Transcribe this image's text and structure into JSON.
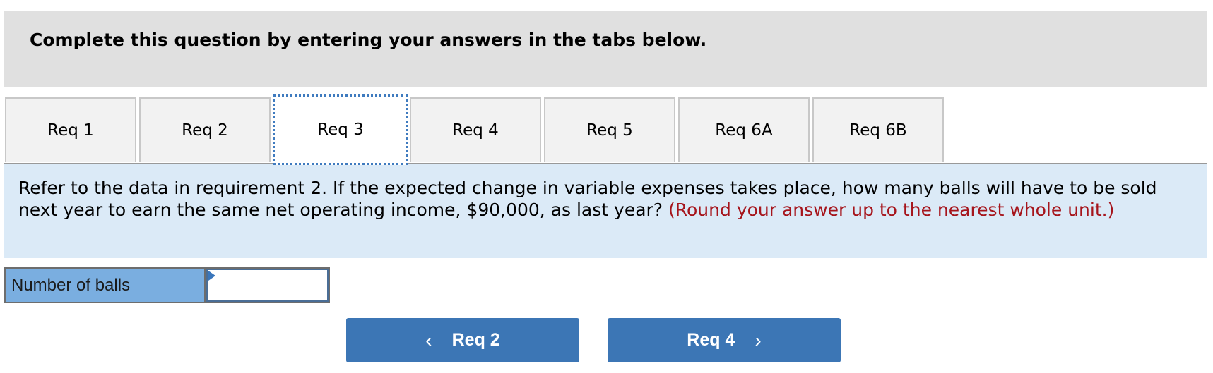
{
  "header": {
    "title": "Complete this question by entering your answers in the tabs below."
  },
  "tabs": [
    {
      "label": "Req 1",
      "active": false
    },
    {
      "label": "Req 2",
      "active": false
    },
    {
      "label": "Req 3",
      "active": true
    },
    {
      "label": "Req 4",
      "active": false
    },
    {
      "label": "Req 5",
      "active": false
    },
    {
      "label": "Req 6A",
      "active": false
    },
    {
      "label": "Req 6B",
      "active": false
    }
  ],
  "question": {
    "text": "Refer to the data in requirement 2. If the expected change in variable expenses takes place, how many balls will have to be sold next year to earn the same net operating income, $90,000, as last year?",
    "hint": "(Round your answer up to the nearest whole unit.)"
  },
  "answer": {
    "label": "Number of balls",
    "value": ""
  },
  "navigation": {
    "prev_label": "Req 2",
    "prev_icon": "chevron-left-icon",
    "next_label": "Req 4",
    "next_icon": "chevron-right-icon"
  },
  "colors": {
    "header_bg": "#e0e0e0",
    "panel_bg": "#dbeaf7",
    "hint_red": "#a6151c",
    "button_blue": "#3c76b5",
    "label_blue": "#7aaee0"
  }
}
